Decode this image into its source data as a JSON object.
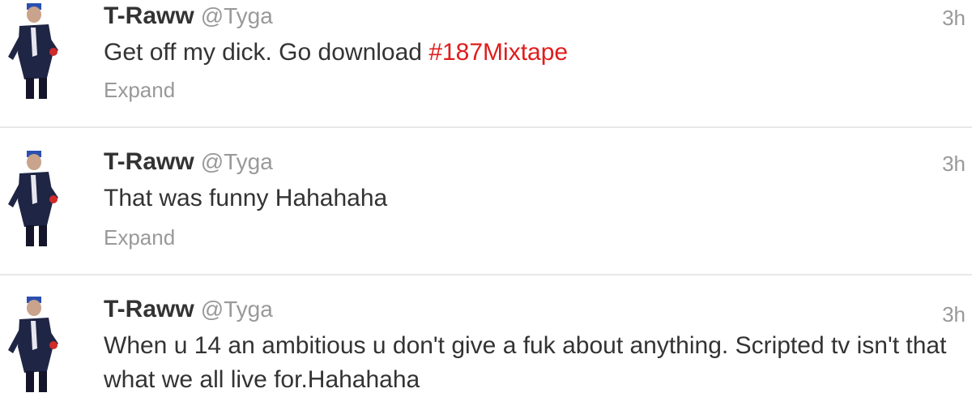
{
  "tweets": [
    {
      "fullname": "T-Raww",
      "username": "@Tyga",
      "time": "3h",
      "text_plain": "Get off my dick. Go download ",
      "hashtag": "#187Mixtape",
      "expand_label": "Expand"
    },
    {
      "fullname": "T-Raww",
      "username": "@Tyga",
      "time": "3h",
      "text_plain": "That was funny Hahahaha",
      "expand_label": "Expand"
    },
    {
      "fullname": "T-Raww",
      "username": "@Tyga",
      "time": "3h",
      "text_plain": "When u 14 an ambitious u don't give a fuk about anything. Scripted tv isn't that what we all live for.Hahahaha"
    }
  ],
  "colors": {
    "hashtag": "#e01d1d",
    "name": "#333333",
    "muted": "#999999",
    "divider": "#e8e8e8"
  },
  "icons": {
    "avatar": "user-avatar-photo"
  }
}
